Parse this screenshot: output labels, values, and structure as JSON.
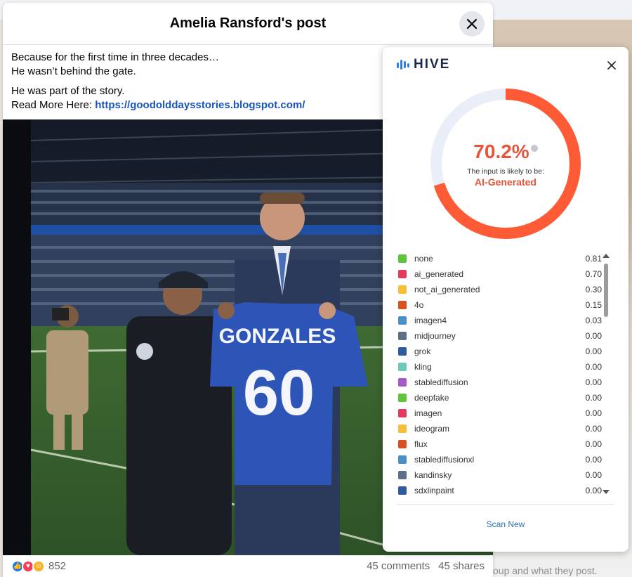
{
  "post": {
    "title": "Amelia Ransford's post",
    "text_lines": [
      "Because for the first time in three decades…",
      "He wasn’t behind the gate.",
      "He was part of the story."
    ],
    "read_more_prefix": "Read More Here: ",
    "link_text": "https://goodolddaysstories.blogspot.com/",
    "photo": {
      "banner_text": "GONZALES",
      "jersey_number": "60"
    },
    "reaction_count": "852",
    "comments": "45 comments",
    "shares": "45 shares"
  },
  "background": {
    "faded_text": "oup and what they post."
  },
  "hive": {
    "logo_text": "HIVE",
    "percent": "70.2%",
    "percent_value": 70.2,
    "likely_text": "The input is likely to be:",
    "verdict": "AI-Generated",
    "scan_new": "Scan New",
    "colors": {
      "accent": "#ff5a36",
      "track": "#e9eef8"
    },
    "rows": [
      {
        "label": "none",
        "value": "0.81",
        "color": "#5ec43c"
      },
      {
        "label": "ai_generated",
        "value": "0.70",
        "color": "#e23b5b"
      },
      {
        "label": "not_ai_generated",
        "value": "0.30",
        "color": "#f6c036"
      },
      {
        "label": "4o",
        "value": "0.15",
        "color": "#d6531f"
      },
      {
        "label": "imagen4",
        "value": "0.03",
        "color": "#4a90c8"
      },
      {
        "label": "midjourney",
        "value": "0.00",
        "color": "#5e6f86"
      },
      {
        "label": "grok",
        "value": "0.00",
        "color": "#2f5a9e"
      },
      {
        "label": "kling",
        "value": "0.00",
        "color": "#6ec8b8"
      },
      {
        "label": "stablediffusion",
        "value": "0.00",
        "color": "#a35dc4"
      },
      {
        "label": "deepfake",
        "value": "0.00",
        "color": "#5ec43c"
      },
      {
        "label": "imagen",
        "value": "0.00",
        "color": "#e23b5b"
      },
      {
        "label": "ideogram",
        "value": "0.00",
        "color": "#f6c036"
      },
      {
        "label": "flux",
        "value": "0.00",
        "color": "#d6531f"
      },
      {
        "label": "stablediffusionxl",
        "value": "0.00",
        "color": "#4a90c8"
      },
      {
        "label": "kandinsky",
        "value": "0.00",
        "color": "#5e6f86"
      },
      {
        "label": "sdxlinpaint",
        "value": "0.00",
        "color": "#2f5a9e"
      }
    ]
  }
}
